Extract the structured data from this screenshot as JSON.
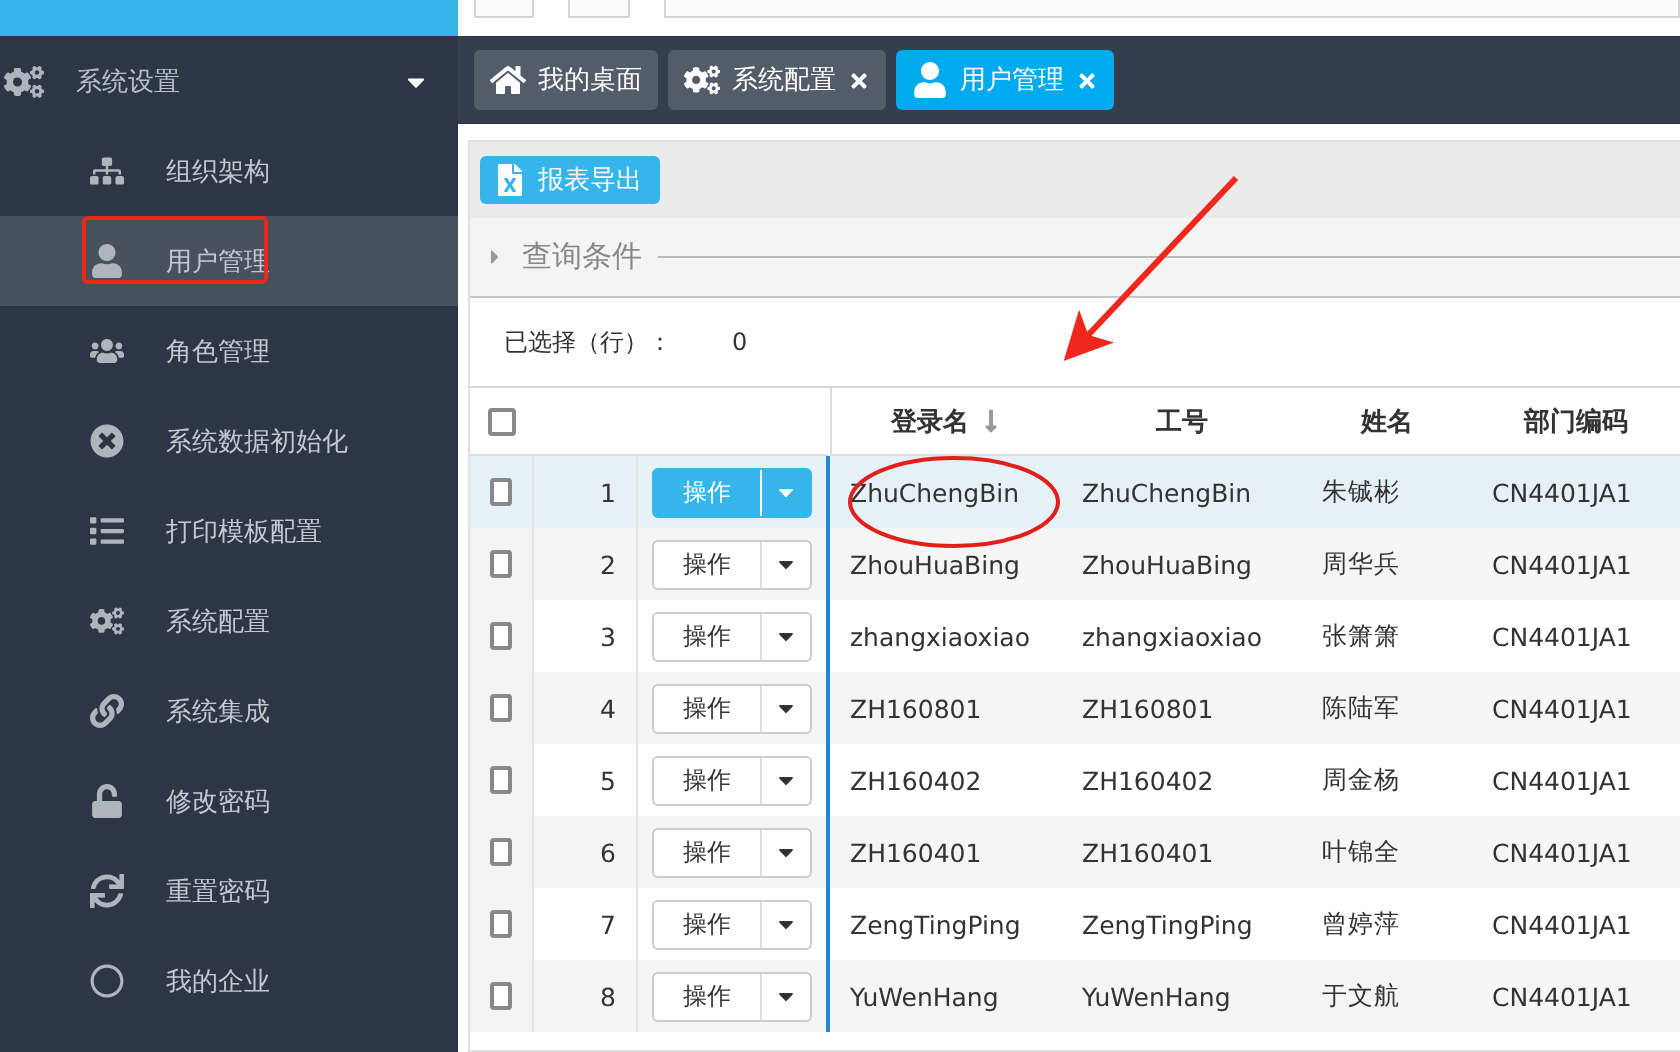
{
  "sidebar": {
    "group": {
      "label": "系统设置",
      "expanded": true
    },
    "items": [
      {
        "label": "组织架构",
        "selected": false
      },
      {
        "label": "用户管理",
        "selected": true
      },
      {
        "label": "角色管理",
        "selected": false
      },
      {
        "label": "系统数据初始化",
        "selected": false
      },
      {
        "label": "打印模板配置",
        "selected": false
      },
      {
        "label": "系统配置",
        "selected": false
      },
      {
        "label": "系统集成",
        "selected": false
      },
      {
        "label": "修改密码",
        "selected": false
      },
      {
        "label": "重置密码",
        "selected": false
      },
      {
        "label": "我的企业",
        "selected": false
      }
    ]
  },
  "tabs": [
    {
      "label": "我的桌面",
      "selected": false,
      "closable": false
    },
    {
      "label": "系统配置",
      "selected": false,
      "closable": true
    },
    {
      "label": "用户管理",
      "selected": true,
      "closable": true
    }
  ],
  "toolbar": {
    "export_button": "报表导出"
  },
  "query": {
    "label": "查询条件",
    "expanded": false
  },
  "selection": {
    "label": "已选择（行）：",
    "count": "0"
  },
  "table": {
    "header_checked": false,
    "columns": [
      {
        "label": "登录名",
        "sorted": true
      },
      {
        "label": "工号",
        "sorted": false
      },
      {
        "label": "姓名",
        "sorted": false
      },
      {
        "label": "部门编码",
        "sorted": false
      }
    ],
    "rows": [
      {
        "number": "1",
        "action": "操作",
        "checked": false,
        "selected": true,
        "cells": [
          "ZhuChengBin",
          "ZhuChengBin",
          "朱铖彬",
          "CN4401JA1"
        ]
      },
      {
        "number": "2",
        "action": "操作",
        "checked": false,
        "selected": false,
        "cells": [
          "ZhouHuaBing",
          "ZhouHuaBing",
          "周华兵",
          "CN4401JA1"
        ]
      },
      {
        "number": "3",
        "action": "操作",
        "checked": false,
        "selected": false,
        "cells": [
          "zhangxiaoxiao",
          "zhangxiaoxiao",
          "张箫箫",
          "CN4401JA1"
        ]
      },
      {
        "number": "4",
        "action": "操作",
        "checked": false,
        "selected": false,
        "cells": [
          "ZH160801",
          "ZH160801",
          "陈陆军",
          "CN4401JA1"
        ]
      },
      {
        "number": "5",
        "action": "操作",
        "checked": false,
        "selected": false,
        "cells": [
          "ZH160402",
          "ZH160402",
          "周金杨",
          "CN4401JA1"
        ]
      },
      {
        "number": "6",
        "action": "操作",
        "checked": false,
        "selected": false,
        "cells": [
          "ZH160401",
          "ZH160401",
          "叶锦全",
          "CN4401JA1"
        ]
      },
      {
        "number": "7",
        "action": "操作",
        "checked": false,
        "selected": false,
        "cells": [
          "ZengTingPing",
          "ZengTingPing",
          "曾婷萍",
          "CN4401JA1"
        ]
      },
      {
        "number": "8",
        "action": "操作",
        "checked": false,
        "selected": false,
        "cells": [
          "YuWenHang",
          "YuWenHang",
          "于文航",
          "CN4401JA1"
        ]
      }
    ]
  },
  "annotations": [
    {
      "kind": "rectangle"
    },
    {
      "kind": "ellipse"
    },
    {
      "kind": "arrow"
    }
  ]
}
